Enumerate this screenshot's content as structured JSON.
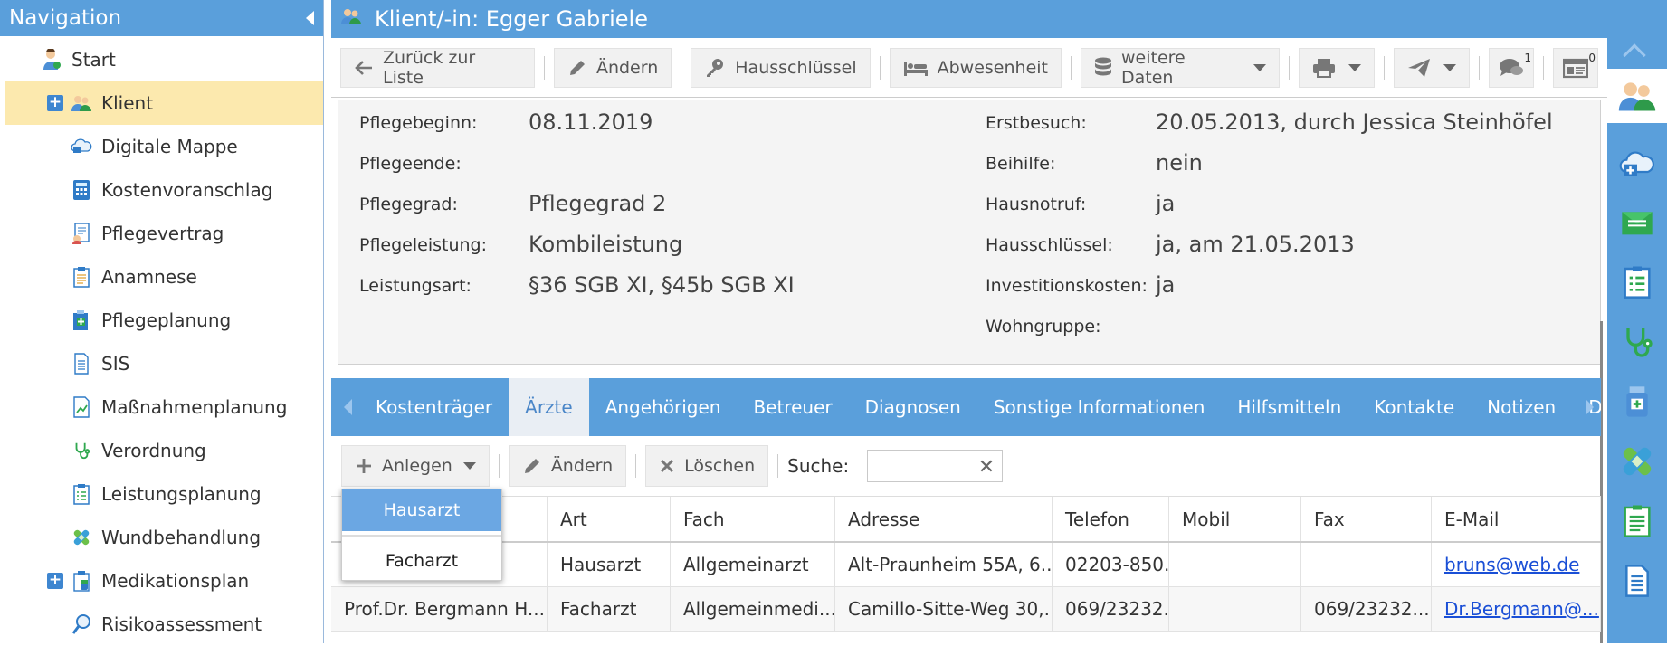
{
  "nav": {
    "title": "Navigation",
    "items": [
      {
        "label": "Start",
        "icon": "start-user-icon",
        "indent": false,
        "plus": false,
        "active": false
      },
      {
        "label": "Klient",
        "icon": "clients-icon",
        "indent": false,
        "plus": true,
        "active": true
      },
      {
        "label": "Digitale Mappe",
        "icon": "cloud-folder-icon",
        "indent": true,
        "plus": false,
        "active": false
      },
      {
        "label": "Kostenvoranschlag",
        "icon": "calculator-icon",
        "indent": true,
        "plus": false,
        "active": false
      },
      {
        "label": "Pflegevertrag",
        "icon": "contract-icon",
        "indent": true,
        "plus": false,
        "active": false
      },
      {
        "label": "Anamnese",
        "icon": "clipboard-icon",
        "indent": true,
        "plus": false,
        "active": false
      },
      {
        "label": "Pflegeplanung",
        "icon": "medical-plan-icon",
        "indent": true,
        "plus": false,
        "active": false
      },
      {
        "label": "SIS",
        "icon": "document-icon",
        "indent": true,
        "plus": false,
        "active": false
      },
      {
        "label": "Maßnahmenplanung",
        "icon": "chart-doc-icon",
        "indent": true,
        "plus": false,
        "active": false
      },
      {
        "label": "Verordnung",
        "icon": "stethoscope-icon",
        "indent": true,
        "plus": false,
        "active": false
      },
      {
        "label": "Leistungsplanung",
        "icon": "checklist-icon",
        "indent": true,
        "plus": false,
        "active": false
      },
      {
        "label": "Wundbehandlung",
        "icon": "bandage-icon",
        "indent": true,
        "plus": false,
        "active": false
      },
      {
        "label": "Medikationsplan",
        "icon": "medication-icon",
        "indent": true,
        "plus": true,
        "active": false
      },
      {
        "label": "Risikoassessment",
        "icon": "magnifier-icon",
        "indent": true,
        "plus": false,
        "active": false
      }
    ]
  },
  "header": {
    "title": "Klient/-in: Egger Gabriele"
  },
  "toolbar": {
    "back_label": "Zurück zur Liste",
    "edit_label": "Ändern",
    "key_label": "Hausschlüssel",
    "absence_label": "Abwesenheit",
    "more_label": "weitere Daten",
    "chat_count": "1",
    "card_count": "0"
  },
  "info": {
    "left": [
      {
        "label": "Pflegebeginn:",
        "value": "08.11.2019"
      },
      {
        "label": "Pflegeende:",
        "value": ""
      },
      {
        "label": "Pflegegrad:",
        "value": "Pflegegrad 2"
      },
      {
        "label": "Pflegeleistung:",
        "value": "Kombileistung"
      },
      {
        "label": "Leistungsart:",
        "value": "§36 SGB XI, §45b SGB XI"
      }
    ],
    "right": [
      {
        "label": "Erstbesuch:",
        "value": "20.05.2013, durch Jessica Steinhöfel"
      },
      {
        "label": "Beihilfe:",
        "value": "nein"
      },
      {
        "label": "Hausnotruf:",
        "value": "ja"
      },
      {
        "label": "Hausschlüssel:",
        "value": "ja, am 21.05.2013"
      },
      {
        "label": "Investitionskosten:",
        "value": "ja"
      },
      {
        "label": "Wohngruppe:",
        "value": ""
      }
    ]
  },
  "tabs": [
    "Kostenträger",
    "Ärzte",
    "Angehörigen",
    "Betreuer",
    "Diagnosen",
    "Sonstige Informationen",
    "Hilfsmitteln",
    "Kontakte",
    "Notizen",
    "Dokum"
  ],
  "active_tab": "Ärzte",
  "subtoolbar": {
    "create_label": "Anlegen",
    "edit_label": "Ändern",
    "delete_label": "Löschen",
    "search_label": "Suche:",
    "search_value": ""
  },
  "dropdown": {
    "items": [
      "Hausarzt",
      "Facharzt"
    ],
    "highlighted": "Hausarzt"
  },
  "table": {
    "columns": [
      "",
      "Art",
      "Fach",
      "Adresse",
      "Telefon",
      "Mobil",
      "Fax",
      "E-Mail"
    ],
    "rows": [
      [
        "",
        "Hausarzt",
        "Allgemeinarzt",
        "Alt-Praunheim 55A, 6...",
        "02203-850...",
        "",
        "",
        "bruns@web.de"
      ],
      [
        "Prof.Dr. Bergmann H...",
        "Facharzt",
        "Allgemeinmedi...",
        "Camillo-Sitte-Weg 30,...",
        "069/23232...",
        "",
        "069/23232...",
        "Dr.Bergmann@..."
      ]
    ]
  },
  "colors": {
    "accent": "#5a9fdb",
    "active_nav": "#fce9ae",
    "link": "#1a4fd6"
  }
}
